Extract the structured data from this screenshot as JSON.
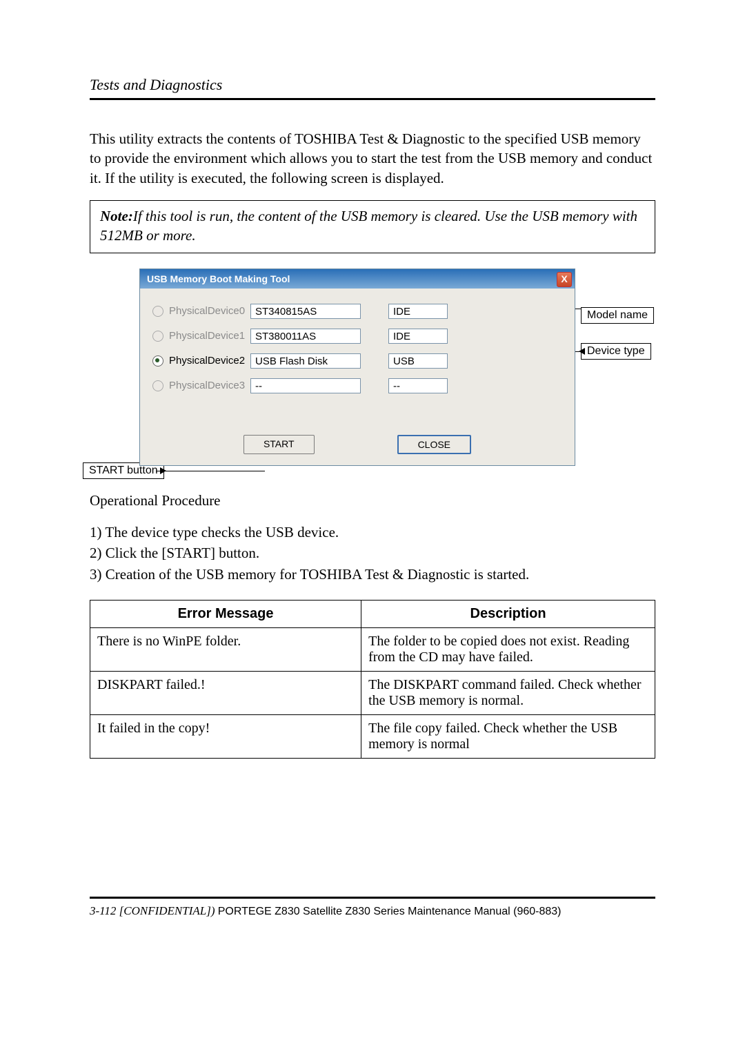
{
  "header": "Tests and Diagnostics",
  "intro": "This utility extracts the contents of TOSHIBA Test & Diagnostic to the specified USB memory to provide the environment which allows you to start the test from the USB memory and conduct it. If the utility is executed, the following screen is displayed.",
  "note": {
    "label": "Note:",
    "text": "If this tool is run, the content of the USB memory is cleared. Use the USB memory with 512MB or more."
  },
  "tool": {
    "title": "USB Memory Boot Making Tool",
    "close_x": "X",
    "devices": [
      {
        "label": "PhysicalDevice0",
        "model": "ST340815AS",
        "type": "IDE",
        "selected": false,
        "enabled": false
      },
      {
        "label": "PhysicalDevice1",
        "model": "ST380011AS",
        "type": "IDE",
        "selected": false,
        "enabled": false
      },
      {
        "label": "PhysicalDevice2",
        "model": "USB Flash Disk",
        "type": "USB",
        "selected": true,
        "enabled": true
      },
      {
        "label": "PhysicalDevice3",
        "model": "--",
        "type": "--",
        "selected": false,
        "enabled": false
      }
    ],
    "start": "START",
    "close": "CLOSE"
  },
  "callouts": {
    "model_name": "Model name",
    "device_type": "Device type",
    "start_button": "START button"
  },
  "op_title": "Operational Procedure",
  "steps": {
    "s1": "1) The device type checks the USB device.",
    "s2": "2) Click the [START] button.",
    "s3": "3) Creation of the USB memory for TOSHIBA Test & Diagnostic is started."
  },
  "table": {
    "head_error": "Error Message",
    "head_desc": "Description",
    "rows": [
      {
        "err": "There is no WinPE folder.",
        "desc": "The folder to be copied does not exist. Reading from the CD may have failed."
      },
      {
        "err": "DISKPART failed.!",
        "desc": "The DISKPART command failed. Check whether the USB memory is normal."
      },
      {
        "err": "It failed in the copy!",
        "desc": "The file copy failed. Check whether the USB memory is normal"
      }
    ]
  },
  "footer": {
    "page": "3-112 [CONFIDENTIAL]) ",
    "manual": "PORTEGE Z830 Satellite Z830 Series Maintenance Manual (960-883)"
  }
}
